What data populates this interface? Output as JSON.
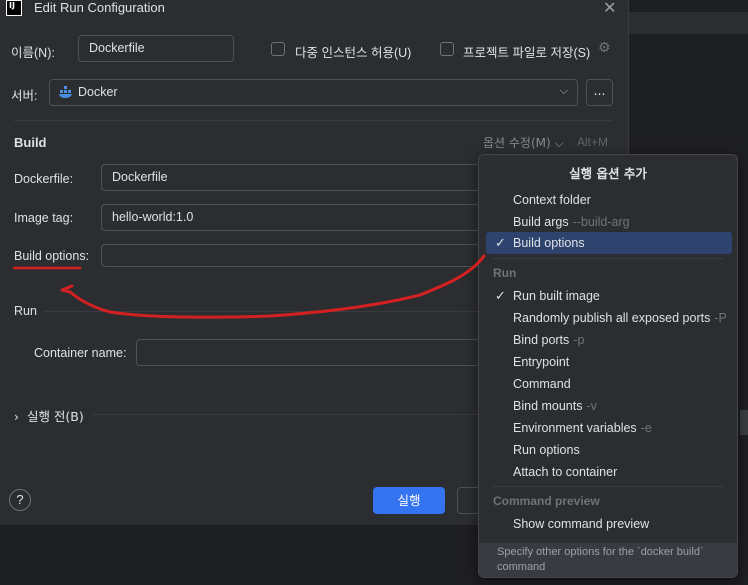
{
  "window": {
    "title": "Edit Run Configuration"
  },
  "name_field": {
    "label": "이름(N):",
    "value": "Dockerfile"
  },
  "allow_multiple": {
    "label": "다중 인스턴스 허용(U)"
  },
  "store_as_project_file": {
    "label": "프로젝트 파일로 저장(S)"
  },
  "server": {
    "label": "서버:",
    "value": "Docker",
    "browse_label": "..."
  },
  "build": {
    "section_label": "Build",
    "modify_options_label": "옵션 수정(M)",
    "modify_options_shortcut": "Alt+M",
    "dockerfile_label": "Dockerfile:",
    "dockerfile_value": "Dockerfile",
    "image_tag_label": "Image tag:",
    "image_tag_value": "hello-world:1.0",
    "build_options_label": "Build options:",
    "build_options_value": ""
  },
  "run": {
    "section_label": "Run",
    "container_name_label": "Container name:",
    "container_name_value": ""
  },
  "before_launch": {
    "label": "실행 전(B)"
  },
  "footer": {
    "help_label": "?",
    "run_label": "실행"
  },
  "popup": {
    "title": "실행 옵션 추가",
    "build_items": [
      {
        "label": "Context folder",
        "hint": "",
        "checked": false
      },
      {
        "label": "Build args",
        "hint": "--build-arg",
        "checked": false
      },
      {
        "label": "Build options",
        "hint": "",
        "checked": true
      }
    ],
    "run_group": "Run",
    "run_items": [
      {
        "label": "Run built image",
        "hint": "",
        "checked": true
      },
      {
        "label": "Randomly publish all exposed ports",
        "hint": "-P",
        "checked": false
      },
      {
        "label": "Bind ports",
        "hint": "-p",
        "checked": false
      },
      {
        "label": "Entrypoint",
        "hint": "",
        "checked": false
      },
      {
        "label": "Command",
        "hint": "",
        "checked": false
      },
      {
        "label": "Bind mounts",
        "hint": "-v",
        "checked": false
      },
      {
        "label": "Environment variables",
        "hint": "-e",
        "checked": false
      },
      {
        "label": "Run options",
        "hint": "",
        "checked": false
      },
      {
        "label": "Attach to container",
        "hint": "",
        "checked": false
      }
    ],
    "preview_group": "Command preview",
    "preview_items": [
      {
        "label": "Show command preview",
        "hint": "",
        "checked": false
      }
    ],
    "footer_text": "Specify other options for the `docker build` command"
  },
  "colors": {
    "accent": "#3574f0",
    "selection": "#2e436e",
    "annotation": "#d32020"
  }
}
